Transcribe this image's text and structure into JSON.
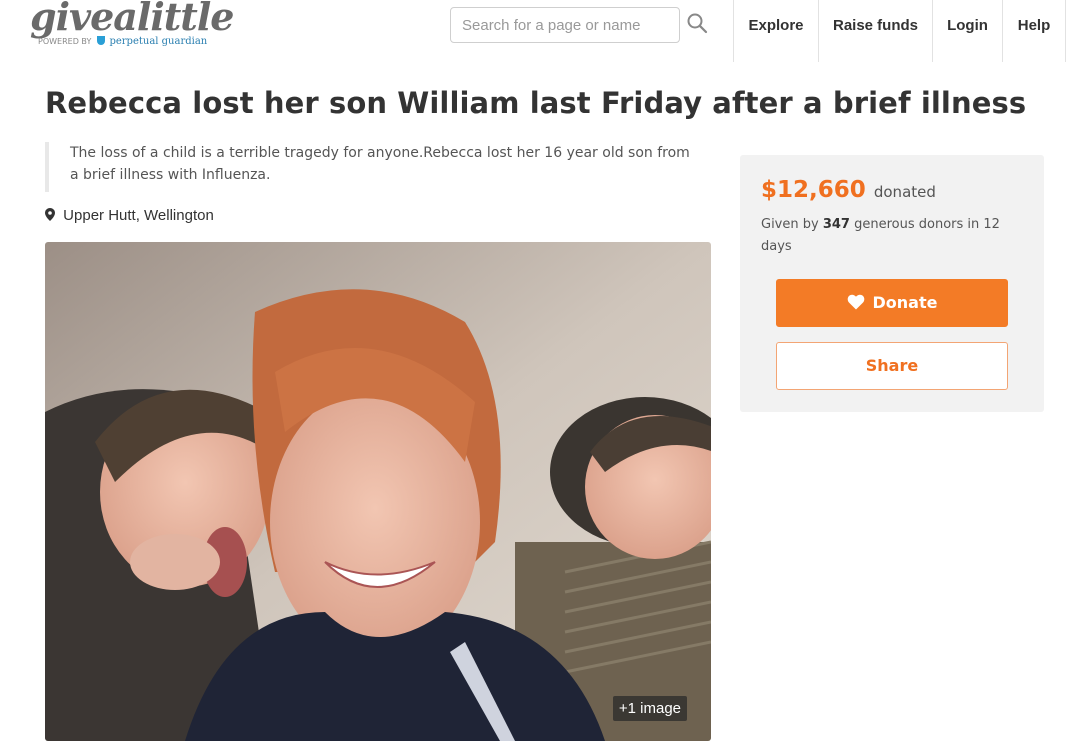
{
  "header": {
    "logo": {
      "wordmark": "givealittle",
      "powered_by": "POWERED BY",
      "partner": "perpetual guardian"
    },
    "search": {
      "placeholder": "Search for a page or name",
      "value": ""
    },
    "nav": {
      "explore": "Explore",
      "raise_funds": "Raise funds",
      "login": "Login",
      "help": "Help"
    }
  },
  "page": {
    "title": "Rebecca lost her son William last Friday after a brief illness",
    "blurb": "The loss of a child is a terrible tragedy for anyone.Rebecca lost her 16 year old son from a brief illness with Influenza.",
    "location": "Upper Hutt, Wellington",
    "photo": {
      "extra_images_label": "+1 image"
    }
  },
  "sidebar": {
    "amount": "$12,660",
    "amount_label": "donated",
    "given_by_prefix": "Given by",
    "donor_count": "347",
    "given_by_suffix": "generous donors in 12 days",
    "donate_label": "Donate",
    "share_label": "Share"
  },
  "colors": {
    "accent": "#f37b26",
    "text": "#333333",
    "panel": "#f2f2f2"
  },
  "icons": [
    "search-icon",
    "map-marker-icon",
    "heart-icon"
  ]
}
